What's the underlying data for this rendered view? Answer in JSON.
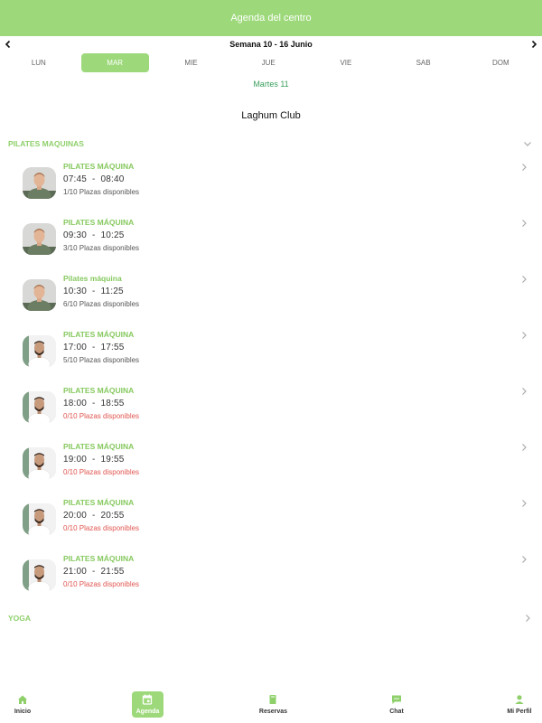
{
  "header": {
    "title": "Agenda del centro"
  },
  "week": {
    "label": "Semana 10 - 16 Junio"
  },
  "days": [
    "LUN",
    "MAR",
    "MIE",
    "JUE",
    "VIE",
    "SAB",
    "DOM"
  ],
  "selected_day_index": 1,
  "selected_date": "Martes 11",
  "club": "Laghum Club",
  "sections": [
    {
      "title": "PILATES MAQUINAS",
      "expanded": true
    },
    {
      "title": "YOGA",
      "expanded": false
    }
  ],
  "classes": [
    {
      "name": "PILATES MÁQUINA",
      "start": "07:45",
      "end": "08:40",
      "spots": "1/10 Plazas disponibles",
      "full": false,
      "instructor": "a"
    },
    {
      "name": "PILATES MÁQUINA",
      "start": "09:30",
      "end": "10:25",
      "spots": "3/10 Plazas disponibles",
      "full": false,
      "instructor": "a"
    },
    {
      "name": "Pilates máquina",
      "start": "10:30",
      "end": "11:25",
      "spots": "6/10 Plazas disponibles",
      "full": false,
      "instructor": "a"
    },
    {
      "name": "PILATES MÁQUINA",
      "start": "17:00",
      "end": "17:55",
      "spots": "5/10 Plazas disponibles",
      "full": false,
      "instructor": "b"
    },
    {
      "name": "PILATES MÁQUINA",
      "start": "18:00",
      "end": "18:55",
      "spots": "0/10 Plazas disponibles",
      "full": true,
      "instructor": "b"
    },
    {
      "name": "PILATES MÁQUINA",
      "start": "19:00",
      "end": "19:55",
      "spots": "0/10 Plazas disponibles",
      "full": true,
      "instructor": "b"
    },
    {
      "name": "PILATES MÁQUINA",
      "start": "20:00",
      "end": "20:55",
      "spots": "0/10 Plazas disponibles",
      "full": true,
      "instructor": "b"
    },
    {
      "name": "PILATES MÁQUINA",
      "start": "21:00",
      "end": "21:55",
      "spots": "0/10 Plazas disponibles",
      "full": true,
      "instructor": "b"
    }
  ],
  "bottom_nav": [
    {
      "label": "Inicio",
      "icon": "home-icon",
      "active": false
    },
    {
      "label": "Agenda",
      "icon": "calendar-icon",
      "active": true
    },
    {
      "label": "Reservas",
      "icon": "book-icon",
      "active": false
    },
    {
      "label": "Chat",
      "icon": "chat-icon",
      "active": false
    },
    {
      "label": "Mi Perfil",
      "icon": "person-icon",
      "active": false
    }
  ],
  "colors": {
    "accent": "#9dd97a",
    "class_title": "#86c95f",
    "date_text": "#3a9f5d",
    "full_text": "#e0554f"
  }
}
